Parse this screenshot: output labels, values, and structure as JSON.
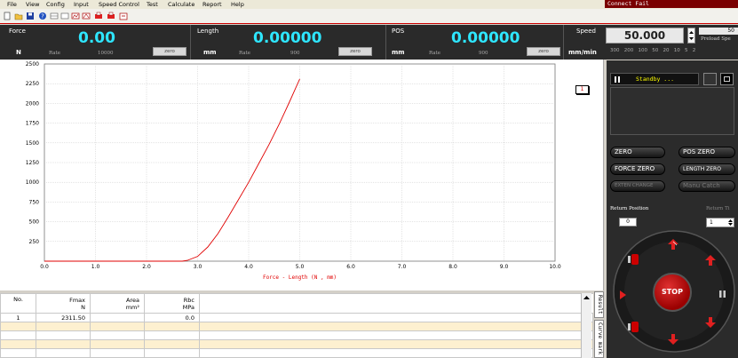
{
  "menu": [
    "File",
    "View",
    "Config",
    "Input",
    "Speed Control",
    "Test",
    "Calculate",
    "Report",
    "Help"
  ],
  "connect_status": "Connect Fail",
  "readouts": {
    "force": {
      "label": "Force",
      "unit": "N",
      "value": "0.00",
      "rate_label": "Rate",
      "rate": "10000",
      "zero": "zero"
    },
    "length": {
      "label": "Length",
      "unit": "mm",
      "value": "0.00000",
      "rate_label": "Rate",
      "rate": "900",
      "zero": "zero"
    },
    "pos": {
      "label": "POS",
      "unit": "mm",
      "value": "0.00000",
      "rate_label": "Rate",
      "rate": "900",
      "zero": "zero"
    }
  },
  "speed": {
    "label": "Speed",
    "unit": "mm/min",
    "value": "50.000",
    "preload_value": "50",
    "preload_label": "Preload Spe",
    "presets": [
      "300",
      "200",
      "100",
      "50",
      "20",
      "10",
      "5",
      "2"
    ]
  },
  "chart_data": {
    "type": "line",
    "title": "",
    "xlabel": "Force - Length    (N , mm)",
    "ylabel": "",
    "xlim": [
      0,
      10
    ],
    "ylim": [
      0,
      2500
    ],
    "x_ticks": [
      "0.0",
      "1.0",
      "2.0",
      "3.0",
      "4.0",
      "5.0",
      "6.0",
      "7.0",
      "8.0",
      "9.0",
      "10.0"
    ],
    "y_ticks": [
      "250",
      "500",
      "750",
      "1000",
      "1250",
      "1500",
      "1750",
      "2000",
      "2250",
      "2500"
    ],
    "grid": true,
    "series": [
      {
        "color": "#e00000",
        "x": [
          0,
          2.7,
          2.8,
          3.0,
          3.2,
          3.4,
          3.6,
          3.8,
          4.0,
          4.2,
          4.4,
          4.6,
          4.8,
          5.0
        ],
        "y": [
          0,
          0,
          10,
          60,
          180,
          350,
          560,
          780,
          1000,
          1240,
          1480,
          1740,
          2020,
          2310
        ]
      }
    ]
  },
  "legend_marker": "1",
  "table": {
    "headers": [
      {
        "top": "No.",
        "bottom": ""
      },
      {
        "top": "Fmax",
        "bottom": "N"
      },
      {
        "top": "Area",
        "bottom": "mm²"
      },
      {
        "top": "Rbc",
        "bottom": "MPa"
      }
    ],
    "rows": [
      [
        "1",
        "2311.50",
        "",
        "0.0"
      ]
    ]
  },
  "side_tabs": [
    "Result",
    "Curve mark"
  ],
  "control": {
    "status": "Standby ...",
    "buttons": {
      "zero": "ZERO",
      "pos_zero": "POS ZERO",
      "force_zero": "FORCE ZERO",
      "length_zero": "LENGTH ZERO",
      "exten_change": "EXTEN CHANGE",
      "manu_catch": "Manu Catch"
    },
    "return_position_label": "Return Position",
    "return_position_value": "0",
    "spin_label": "Return Ti",
    "spin_value": "1",
    "stop": "STOP"
  },
  "colors": {
    "accent_cyan": "#2ee6ff",
    "curve_red": "#e00000",
    "stop_red": "#b00000",
    "alt_row": "#fdf0d0"
  }
}
